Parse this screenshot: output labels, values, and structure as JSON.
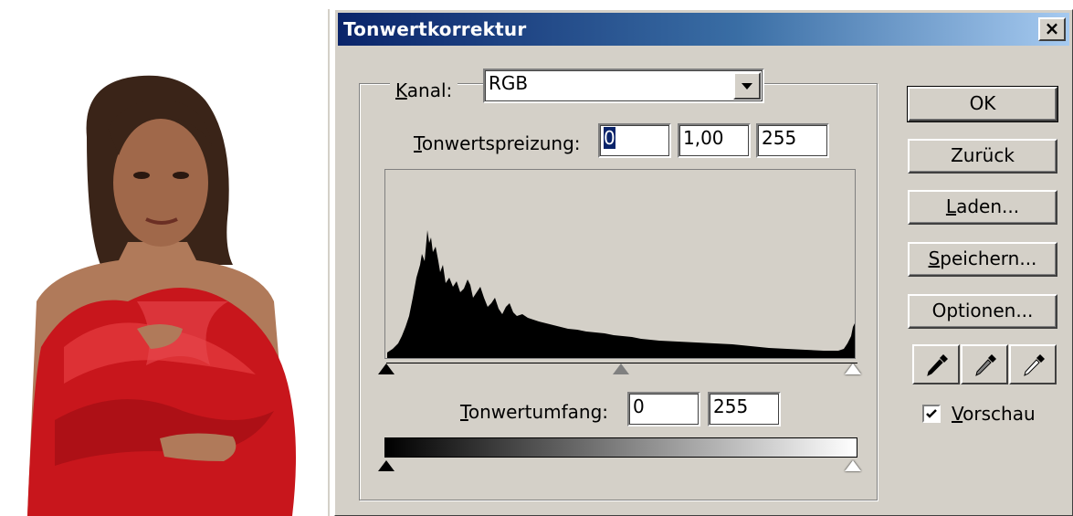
{
  "dialog": {
    "title": "Tonwertkorrektur",
    "close_glyph": "×",
    "kanal": {
      "label_u": "K",
      "label_rest": "anal:",
      "value": "RGB"
    },
    "input_levels": {
      "label_u": "T",
      "label_rest": "onwertspreizung:",
      "black": "0",
      "gamma": "1,00",
      "white": "255"
    },
    "output_levels": {
      "label_u": "T",
      "label_rest": "onwertumfang:",
      "black": "0",
      "white": "255"
    },
    "buttons": {
      "ok": "OK",
      "reset": "Zurück",
      "load_u": "L",
      "load_rest": "aden...",
      "save_u": "S",
      "save_rest": "peichern...",
      "options": "Optionen..."
    },
    "eyedroppers": [
      "black-eyedropper-icon",
      "gray-eyedropper-icon",
      "white-eyedropper-icon"
    ],
    "preview": {
      "label_u": "V",
      "label_rest": "orschau",
      "checked": true
    },
    "colors": {
      "face": "#d4d0c8",
      "title_start": "#0a246a",
      "title_end": "#a6caf0",
      "selection": "#0a246a"
    }
  }
}
